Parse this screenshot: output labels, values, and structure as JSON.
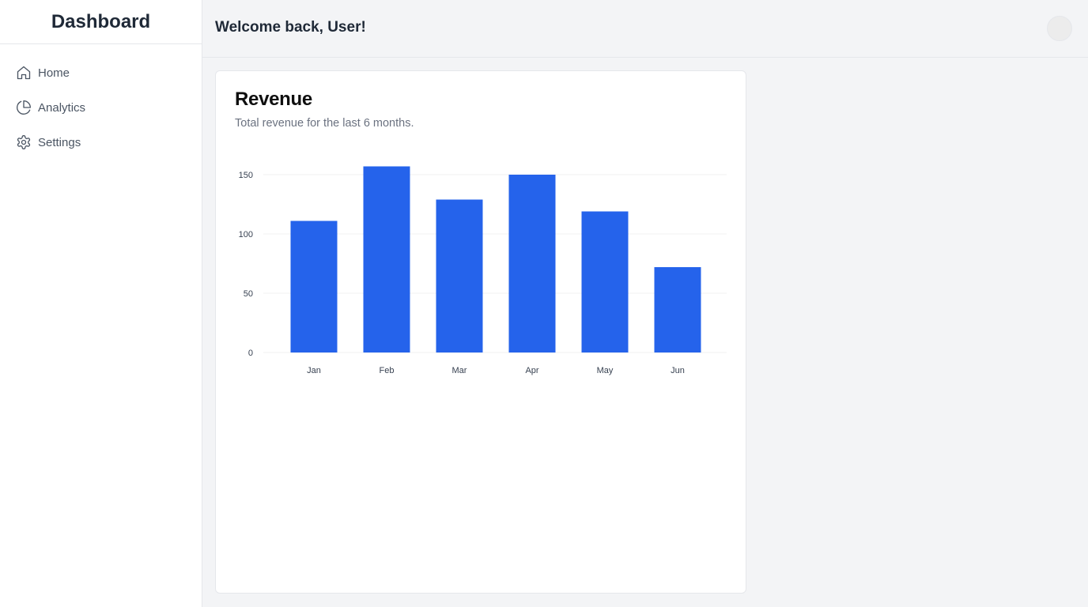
{
  "sidebar": {
    "brand": "Dashboard",
    "items": [
      {
        "label": "Home",
        "icon": "home-icon"
      },
      {
        "label": "Analytics",
        "icon": "pie-chart-icon"
      },
      {
        "label": "Settings",
        "icon": "gear-icon"
      }
    ]
  },
  "header": {
    "welcome": "Welcome back, User!"
  },
  "card": {
    "title": "Revenue",
    "subtitle": "Total revenue for the last 6 months."
  },
  "colors": {
    "accent": "#2563eb",
    "grid": "#f0f0f0"
  },
  "chart_data": {
    "type": "bar",
    "categories": [
      "Jan",
      "Feb",
      "Mar",
      "Apr",
      "May",
      "Jun"
    ],
    "values": [
      111,
      157,
      129,
      150,
      119,
      72
    ],
    "title": "",
    "xlabel": "",
    "ylabel": "",
    "ylim": [
      0,
      150
    ],
    "yticks": [
      0,
      50,
      100,
      150
    ],
    "grid": true
  }
}
